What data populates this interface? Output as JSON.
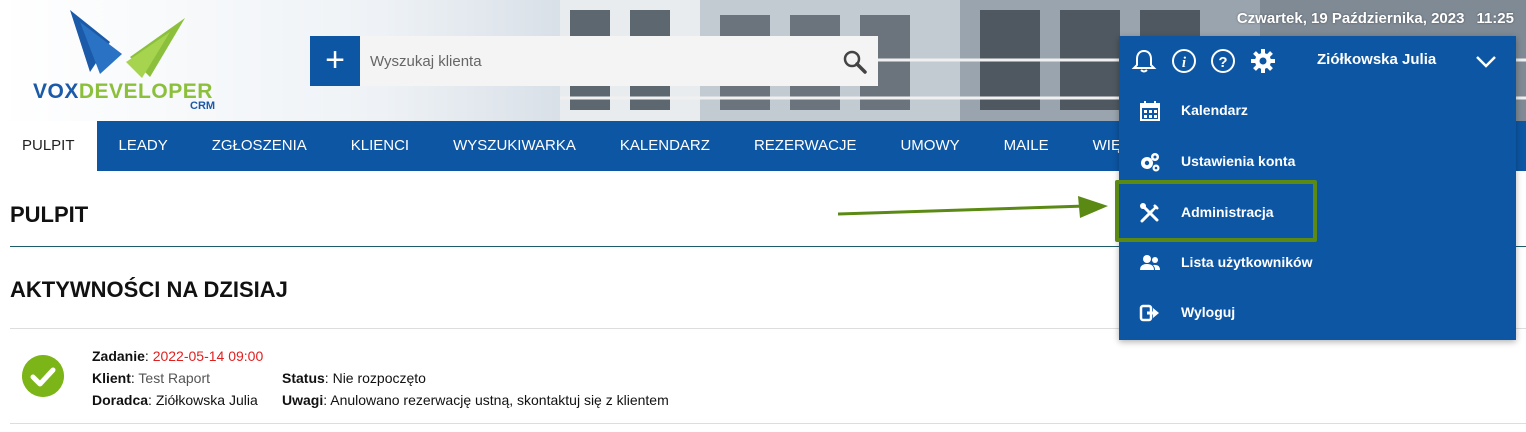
{
  "header": {
    "logo_primary": "VOX",
    "logo_secondary": "DEVELOPER",
    "logo_sub": "CRM",
    "date": "Czwartek, 19 Października, 2023",
    "time": "11:25"
  },
  "search": {
    "add_label": "+",
    "placeholder": "Wyszukaj klienta",
    "value": ""
  },
  "nav": {
    "items": [
      {
        "label": "PULPIT",
        "active": true
      },
      {
        "label": "LEADY"
      },
      {
        "label": "ZGŁOSZENIA"
      },
      {
        "label": "KLIENCI"
      },
      {
        "label": "WYSZUKIWARKA"
      },
      {
        "label": "KALENDARZ"
      },
      {
        "label": "REZERWACJE"
      },
      {
        "label": "UMOWY"
      },
      {
        "label": "MAILE"
      },
      {
        "label": "WIĘ"
      }
    ]
  },
  "main": {
    "page_title": "PULPIT",
    "section_title": "AKTYWNOŚCI NA DZISIAJ",
    "activity": {
      "task_label": "Zadanie",
      "task_date": "2022-05-14 09:00",
      "client_label": "Klient",
      "client_value": "Test Raport",
      "status_label": "Status",
      "status_value": "Nie rozpoczęto",
      "advisor_label": "Doradca",
      "advisor_value": "Ziółkowska Julia",
      "notes_label": "Uwagi",
      "notes_value": "Anulowano rezerwację ustną, skontaktuj się z klientem"
    }
  },
  "user_menu": {
    "user_name": "Ziółkowska Julia",
    "top_icons": [
      "bell-icon",
      "info-icon",
      "help-icon",
      "gear-icon"
    ],
    "items": [
      {
        "label": "Kalendarz",
        "icon": "calendar-icon"
      },
      {
        "label": "Ustawienia konta",
        "icon": "cogs-icon"
      },
      {
        "label": "Administracja",
        "icon": "tools-icon"
      },
      {
        "label": "Lista użytkowników",
        "icon": "users-icon"
      },
      {
        "label": "Wyloguj",
        "icon": "logout-icon"
      }
    ]
  },
  "colors": {
    "brand_blue": "#0c56a4",
    "accent_green": "#7cb518",
    "date_red": "#e02020",
    "highlight_green": "#5b8a14"
  }
}
